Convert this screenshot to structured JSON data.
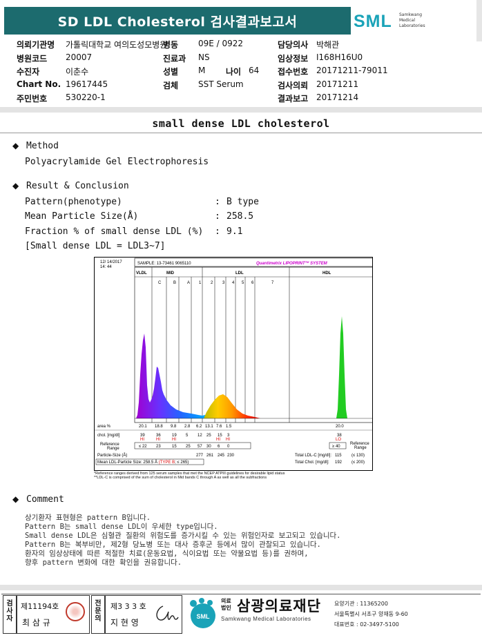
{
  "header": {
    "title": "SD LDL Cholesterol 검사결과보고서",
    "logo_text": "SML",
    "logo_sub": [
      "Samkwang",
      "Medical",
      "Laboratories"
    ]
  },
  "patient_info": [
    {
      "label": "의뢰기관명",
      "value": "가톨릭대학교 여의도성모병원"
    },
    {
      "label": "병동",
      "value": "09E / 0922"
    },
    {
      "label": "담당의사",
      "value": "박해관"
    },
    {
      "label": "병원코드",
      "value": "20007"
    },
    {
      "label": "진료과",
      "value": "NS"
    },
    {
      "label": "임상정보",
      "value": "I168H16U0"
    },
    {
      "label": "수진자",
      "value": "이춘수"
    },
    {
      "label": "성별",
      "value": "M"
    },
    {
      "label": "나이",
      "value": "64"
    },
    {
      "label": "접수번호",
      "value": "20171211-79011"
    },
    {
      "label": "Chart No.",
      "value": "19617445"
    },
    {
      "label": "검체",
      "value": "SST Serum"
    },
    {
      "label": "검사의뢰",
      "value": "20171211"
    },
    {
      "label": "주민번호",
      "value": "530220-1"
    },
    {
      "label": "결과보고",
      "value": "20171214"
    }
  ],
  "section_title": "small dense LDL cholesterol",
  "method": {
    "heading": "Method",
    "text": "Polyacrylamide Gel Electrophoresis"
  },
  "result": {
    "heading": "Result & Conclusion",
    "rows": [
      {
        "label": "Pattern(phenotype)",
        "value": "B type"
      },
      {
        "label": "Mean Particle Size(Å)",
        "value": "258.5"
      },
      {
        "label": "Fraction % of small dense LDL (%)",
        "value": "9.1"
      }
    ],
    "note": "[Small dense LDL = LDL3~7]"
  },
  "chart": {
    "date": "12/ 14/2017",
    "time": "14: 44",
    "sample": "SAMPLE:  13-73461 9065110",
    "brand": "Quantimetrix LIPOPRINT",
    "brand_sup": "TM",
    "brand_tail": " SYSTEM",
    "bands": {
      "vldl": "VLDL",
      "mid": "MID",
      "ldl": "LDL",
      "hdl": "HDL"
    },
    "sub_bands": [
      "C",
      "B",
      "A",
      "1",
      "2",
      "3",
      "4",
      "5",
      "6",
      "7"
    ],
    "row_labels": {
      "area": "area %",
      "chol": "chol. [mg/dl]",
      "ref": "Reference\nRange",
      "ref_right": "Reference\nRange"
    },
    "area": [
      "20.1",
      "18.8",
      "9.8",
      "2.8",
      "6.2",
      "13.1",
      "7.6",
      "1.5",
      "",
      "",
      "20.0"
    ],
    "chol": [
      "39",
      "36",
      "19",
      "5",
      "12",
      "25",
      "15",
      "3",
      "",
      "",
      "38"
    ],
    "flags": [
      "HI",
      "HI",
      "HI",
      "",
      "",
      "",
      "HI",
      "HI",
      "",
      "",
      "LO"
    ],
    "ref": [
      "≤ 22",
      "23",
      "15",
      "25",
      "57",
      "30",
      "6",
      "0",
      "",
      "",
      "≥ 40"
    ],
    "particle_size_label": "Particle-Size (Å)",
    "particle_sizes": [
      "277",
      "261",
      "245",
      "230"
    ],
    "mean_size_label": "Mean LDL-Particle Size:",
    "mean_size_value": "258.5 Å",
    "mean_size_type": "(TYPE B",
    "mean_size_tail": "; ≤ 265)",
    "total_ldl_label": "Total LDL-C [mg/dl]:",
    "total_ldl_value": "115",
    "total_ldl_ref": "(≤ 130)",
    "total_chol_label": "Total Chol. [mg/dl]:",
    "total_chol_value": "192",
    "total_chol_ref": "(≤ 200)",
    "footnote1": "*Reference ranges derived from 125 serum samples that met the NCEP ATPIII guidelines for desirable lipid status",
    "footnote2": "**LDL-C is comprised of the sum of cholesterol in Mid bands C through A as well as all the subfractions"
  },
  "comment": {
    "heading": "Comment",
    "lines": [
      "상기환자 표현형은 pattern B입니다.",
      "Pattern B는 small dense LDL이 우세한 type입니다.",
      "Small dense LDL은 심혈관 질환의 위험도를 증가시킬 수 있는 위험인자로 보고되고 있습니다.",
      "Pattern B는 복부비만, 제2형 당뇨병 또는 대사 증후군 등에서 많이 관찰되고 있습니다.",
      "환자의 임상상태에 따른 적절한 치료(운동요법, 식이요법 또는 약물요법 등)를 권하며,",
      "향후 pattern 변화에 대한 확인을 권유합니다."
    ]
  },
  "footer": {
    "left_vlabel": [
      "검",
      "사",
      "자"
    ],
    "left_no": "제11194호",
    "left_name": "최 삼 규",
    "mid_vlabel": [
      "전",
      "문",
      "의"
    ],
    "mid_no": "제3 3 3 호",
    "mid_name": "지 현 영",
    "org_prefix": [
      "의료",
      "법인"
    ],
    "org_name": "삼광의료재단",
    "org_en": "Samkwang Medical Laboratories",
    "contact": [
      "요양기관 : 11365200",
      "서울특별시 서초구 양재동 9-60",
      "대표번호 : 02-3497-5100"
    ],
    "logo": "SML"
  }
}
